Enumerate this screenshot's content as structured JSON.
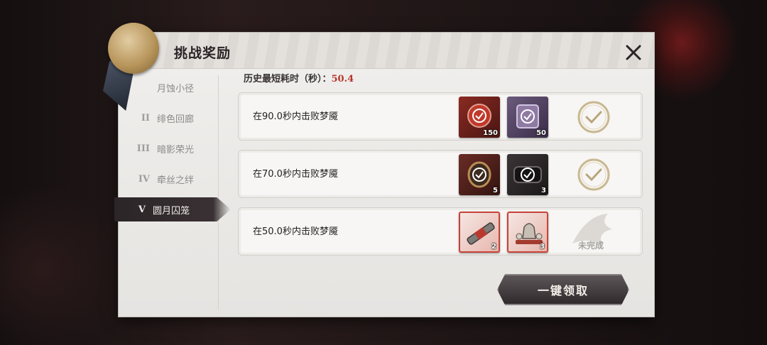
{
  "dialog": {
    "title": "挑战奖励",
    "close_icon": "close-icon"
  },
  "sidebar": {
    "items": [
      {
        "num": "",
        "label": "月蚀小径",
        "active": false
      },
      {
        "num": "II",
        "label": "绯色回廊",
        "active": false
      },
      {
        "num": "III",
        "label": "暗影荣光",
        "active": false
      },
      {
        "num": "IV",
        "label": "牵丝之绊",
        "active": false
      },
      {
        "num": "V",
        "label": "圆月囚笼",
        "active": true
      }
    ]
  },
  "best_time": {
    "label": "历史最短耗时（秒）：",
    "value": "50.4"
  },
  "challenges": [
    {
      "label": "在90.0秒内击败梦魇",
      "rewards": [
        {
          "icon": "red-gem-medal-icon",
          "count": "150"
        },
        {
          "icon": "purple-box-icon",
          "count": "50"
        }
      ],
      "status": "claimed",
      "status_text": ""
    },
    {
      "label": "在70.0秒内击败梦魇",
      "rewards": [
        {
          "icon": "bronze-amulet-icon",
          "count": "5"
        },
        {
          "icon": "dark-bracer-icon",
          "count": "3"
        }
      ],
      "status": "claimed",
      "status_text": ""
    },
    {
      "label": "在50.0秒内击败梦魇",
      "rewards": [
        {
          "icon": "scroll-bundle-icon",
          "count": "2"
        },
        {
          "icon": "tea-set-icon",
          "count": "3"
        }
      ],
      "status": "incomplete",
      "status_text": "未完成"
    }
  ],
  "collect_button": {
    "label": "一键领取"
  },
  "colors": {
    "accent_red": "#b5362b",
    "panel_bg": "#eeedeb",
    "button_dark": "#3a3436"
  }
}
